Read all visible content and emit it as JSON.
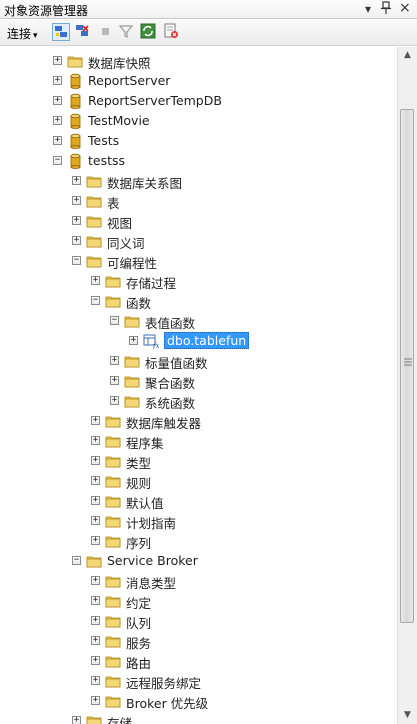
{
  "window": {
    "title": "对象资源管理器",
    "dropdown_glyph": "▾",
    "pin_glyph": "ᵖ",
    "close_glyph": "×"
  },
  "toolbar": {
    "connect_label": "连接",
    "connect_arrow": "▾",
    "buttons": [
      {
        "name": "connect-explorer-icon"
      },
      {
        "name": "disconnect-icon"
      },
      {
        "name": "stop-icon"
      },
      {
        "name": "filter-icon"
      },
      {
        "name": "refresh-icon"
      },
      {
        "name": "summary-icon"
      }
    ]
  },
  "colors": {
    "folder": "#e8c24a",
    "database": "#e0a81c",
    "selection": "#3399ff"
  },
  "tree": [
    {
      "label": "数据库快照",
      "level": 0,
      "icon": "folder",
      "state": "collapsed"
    },
    {
      "label": "ReportServer",
      "level": 0,
      "icon": "database",
      "state": "collapsed"
    },
    {
      "label": "ReportServerTempDB",
      "level": 0,
      "icon": "database",
      "state": "collapsed"
    },
    {
      "label": "TestMovie",
      "level": 0,
      "icon": "database",
      "state": "collapsed"
    },
    {
      "label": "Tests",
      "level": 0,
      "icon": "database",
      "state": "collapsed"
    },
    {
      "label": "testss",
      "level": 0,
      "icon": "database",
      "state": "expanded"
    },
    {
      "label": "数据库关系图",
      "level": 1,
      "icon": "folder",
      "state": "collapsed"
    },
    {
      "label": "表",
      "level": 1,
      "icon": "folder",
      "state": "collapsed"
    },
    {
      "label": "视图",
      "level": 1,
      "icon": "folder",
      "state": "collapsed"
    },
    {
      "label": "同义词",
      "level": 1,
      "icon": "folder",
      "state": "collapsed"
    },
    {
      "label": "可编程性",
      "level": 1,
      "icon": "folder",
      "state": "expanded"
    },
    {
      "label": "存储过程",
      "level": 2,
      "icon": "folder",
      "state": "collapsed"
    },
    {
      "label": "函数",
      "level": 2,
      "icon": "folder",
      "state": "expanded"
    },
    {
      "label": "表值函数",
      "level": 3,
      "icon": "folder",
      "state": "expanded"
    },
    {
      "label": "dbo.tablefun",
      "level": 4,
      "icon": "function",
      "state": "collapsed",
      "selected": true
    },
    {
      "label": "标量值函数",
      "level": 3,
      "icon": "folder",
      "state": "collapsed"
    },
    {
      "label": "聚合函数",
      "level": 3,
      "icon": "folder",
      "state": "collapsed"
    },
    {
      "label": "系统函数",
      "level": 3,
      "icon": "folder",
      "state": "collapsed"
    },
    {
      "label": "数据库触发器",
      "level": 2,
      "icon": "folder",
      "state": "collapsed"
    },
    {
      "label": "程序集",
      "level": 2,
      "icon": "folder",
      "state": "collapsed"
    },
    {
      "label": "类型",
      "level": 2,
      "icon": "folder",
      "state": "collapsed"
    },
    {
      "label": "规则",
      "level": 2,
      "icon": "folder",
      "state": "collapsed"
    },
    {
      "label": "默认值",
      "level": 2,
      "icon": "folder",
      "state": "collapsed"
    },
    {
      "label": "计划指南",
      "level": 2,
      "icon": "folder",
      "state": "collapsed"
    },
    {
      "label": "序列",
      "level": 2,
      "icon": "folder",
      "state": "collapsed"
    },
    {
      "label": "Service Broker",
      "level": 1,
      "icon": "folder",
      "state": "expanded"
    },
    {
      "label": "消息类型",
      "level": 2,
      "icon": "folder",
      "state": "collapsed"
    },
    {
      "label": "约定",
      "level": 2,
      "icon": "folder",
      "state": "collapsed"
    },
    {
      "label": "队列",
      "level": 2,
      "icon": "folder",
      "state": "collapsed"
    },
    {
      "label": "服务",
      "level": 2,
      "icon": "folder",
      "state": "collapsed"
    },
    {
      "label": "路由",
      "level": 2,
      "icon": "folder",
      "state": "collapsed"
    },
    {
      "label": "远程服务绑定",
      "level": 2,
      "icon": "folder",
      "state": "collapsed"
    },
    {
      "label": "Broker 优先级",
      "level": 2,
      "icon": "folder",
      "state": "collapsed"
    },
    {
      "label": "存储",
      "level": 1,
      "icon": "folder",
      "state": "collapsed"
    }
  ]
}
